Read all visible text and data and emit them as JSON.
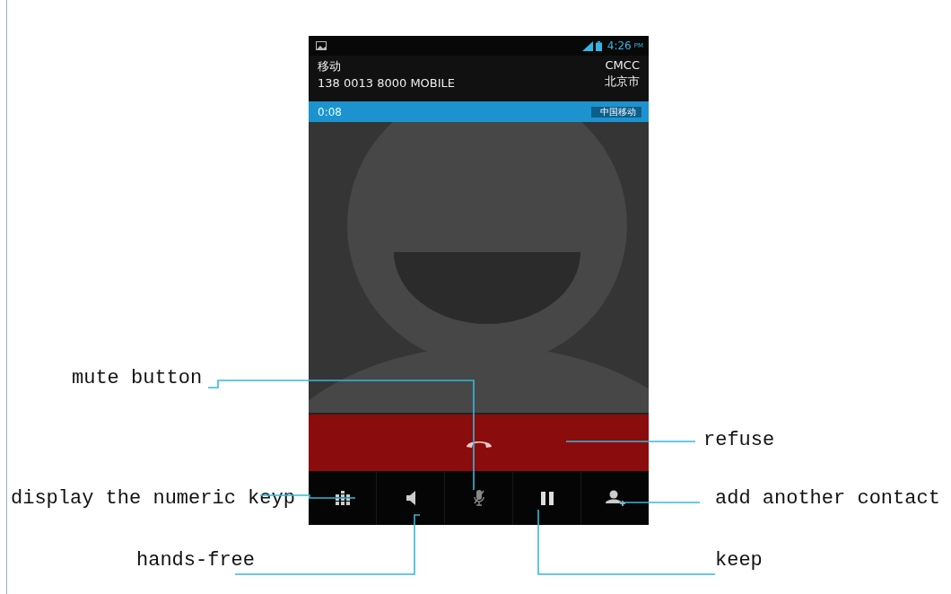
{
  "status_bar": {
    "time": "4:26",
    "time_suffix": "PM"
  },
  "caller": {
    "label": "移动",
    "number": "138 0013 8000 MOBILE",
    "carrier": "CMCC",
    "location": "北京市"
  },
  "call_bar": {
    "duration": "0:08",
    "network_tag": "中国移动"
  },
  "controls": [
    {
      "kind": "keypad"
    },
    {
      "kind": "speaker"
    },
    {
      "kind": "mute"
    },
    {
      "kind": "hold"
    },
    {
      "kind": "add_contact"
    }
  ],
  "annotations": [
    {
      "kind": "mute",
      "text": "mute button"
    },
    {
      "kind": "refuse",
      "text": "refuse"
    },
    {
      "kind": "keypad",
      "text": "display the numeric keyp"
    },
    {
      "kind": "add_contact",
      "text": "add another contact"
    },
    {
      "kind": "speaker",
      "text": "hands-free"
    },
    {
      "kind": "hold",
      "text": "keep"
    }
  ]
}
